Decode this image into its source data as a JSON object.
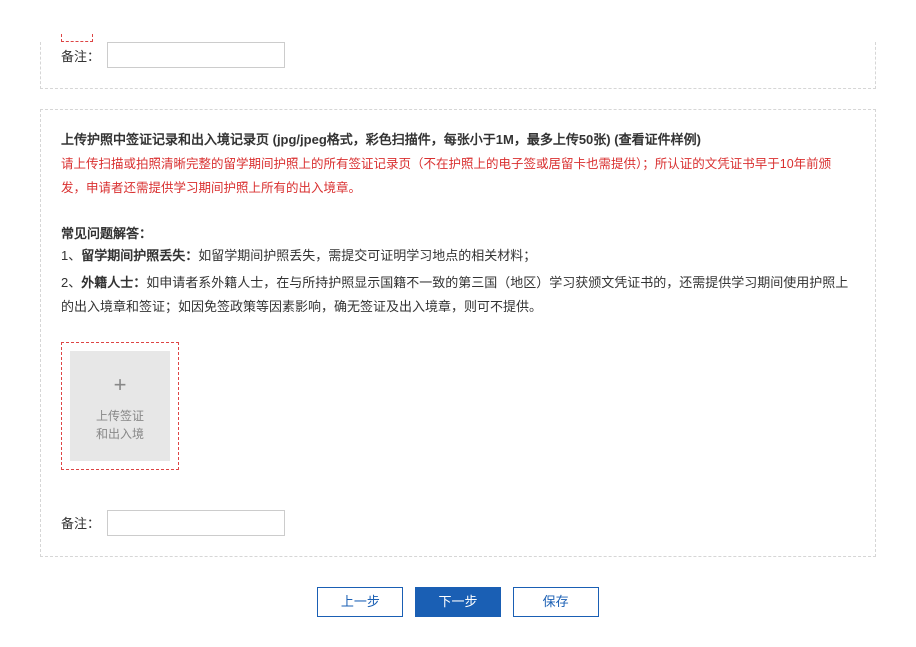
{
  "section1": {
    "remark_label": "备注："
  },
  "section2": {
    "title_prefix": "上传护照中签证记录和出入境记录页 (jpg/jpeg格式，彩色扫描件，每张小于1M，最多上传50张) ",
    "title_link": "(查看证件样例)",
    "red_note": "请上传扫描或拍照清晰完整的留学期间护照上的所有签证记录页（不在护照上的电子签或居留卡也需提供）；所认证的文凭证书早于10年前颁发，申请者还需提供学习期间护照上所有的出入境章。",
    "faq_head": "常见问题解答：",
    "faq1_num": "1、",
    "faq1_b": "留学期间护照丢失：",
    "faq1_rest": "如留学期间护照丢失，需提交可证明学习地点的相关材料；",
    "faq2_num": "2、",
    "faq2_b": "外籍人士：",
    "faq2_rest": "如申请者系外籍人士，在与所持护照显示国籍不一致的第三国（地区）学习获颁文凭证书的，还需提供学习期间使用护照上的出入境章和签证；如因免签政策等因素影响，确无签证及出入境章，则可不提供。",
    "upload_line1": "上传签证",
    "upload_line2": "和出入境",
    "remark_label": "备注："
  },
  "buttons": {
    "prev": "上一步",
    "next": "下一步",
    "save": "保存"
  }
}
